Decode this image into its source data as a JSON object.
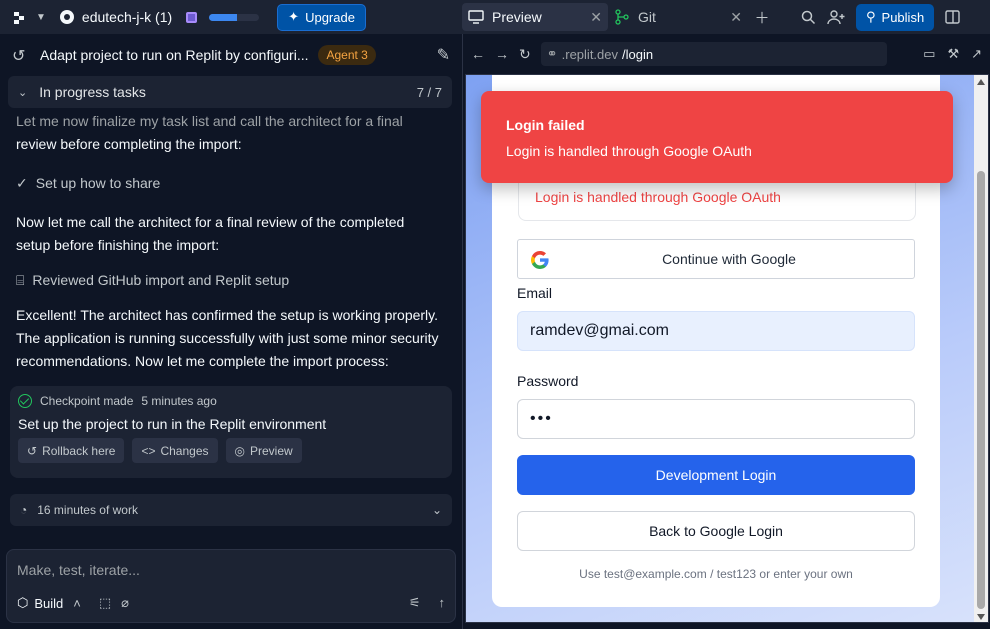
{
  "topbar": {
    "project_name": "edutech-j-k (1)",
    "progress_fraction": 0.55,
    "upgrade_label": "Upgrade",
    "tabs": [
      {
        "label": "Preview",
        "icon": "monitor-icon"
      },
      {
        "label": "Git",
        "icon": "git-branch-icon"
      }
    ],
    "publish_label": "Publish"
  },
  "chat": {
    "title": "Adapt project to run on Replit by configuri...",
    "agent_badge": "Agent 3",
    "in_progress_label": "In progress tasks",
    "in_progress_count": "7 / 7",
    "messages": {
      "m1": "Let me now finalize my task list and call the architect for a final",
      "m1b": "review before completing the import:",
      "task1": "Set up how to share",
      "m2": "Now let me call the architect for a final review of the completed setup before finishing the import:",
      "task2": "Reviewed GitHub import and Replit setup",
      "m3": "Excellent! The architect has confirmed the setup is working properly. The application is running successfully with just some minor security recommendations. Now let me complete the import process:"
    },
    "checkpoint": {
      "label": "Checkpoint made",
      "time": "5 minutes ago",
      "title": "Set up the project to run in the Replit environment",
      "buttons": [
        "Rollback here",
        "Changes",
        "Preview"
      ]
    },
    "work_label": "16 minutes of work",
    "composer": {
      "placeholder": "Make, test, iterate...",
      "mode": "Build"
    }
  },
  "preview": {
    "url_domain": ".replit.dev",
    "url_path": "/login",
    "toast": {
      "title": "Login failed",
      "description": "Login is handled through Google OAuth"
    },
    "error_text": "Login is handled through Google OAuth",
    "google_button": "Continue with Google",
    "email_label": "Email",
    "email_value": "ramdev@gmai.com",
    "password_label": "Password",
    "password_value": "•••",
    "dev_login_button": "Development Login",
    "back_button": "Back to Google Login",
    "hint": "Use test@example.com / test123 or enter your own"
  },
  "colors": {
    "bg": "#0e1525",
    "panel": "#1c2333",
    "accent": "#0053a6",
    "error": "#ef4444",
    "primary": "#2563eb"
  }
}
